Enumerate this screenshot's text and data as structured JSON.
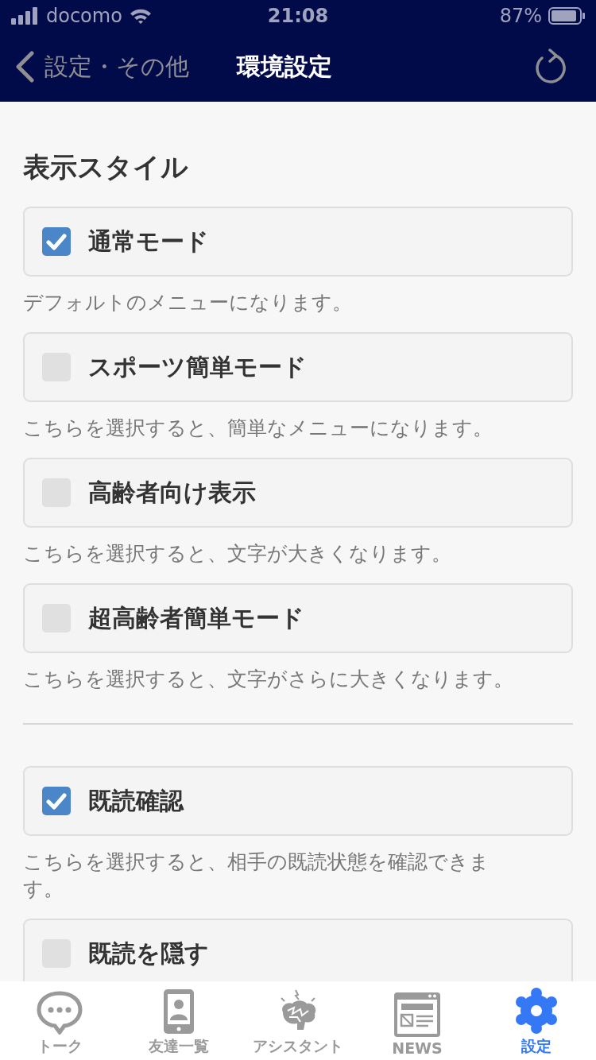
{
  "status_bar": {
    "carrier": "docomo",
    "time": "21:08",
    "battery": "87%"
  },
  "nav": {
    "back": "設定・その他",
    "title": "環境設定"
  },
  "sections": [
    {
      "title": "表示スタイル",
      "options": [
        {
          "label": "通常モード",
          "checked": true,
          "description": "デフォルトのメニューになります。"
        },
        {
          "label": "スポーツ簡単モード",
          "checked": false,
          "description": "こちらを選択すると、簡単なメニューになります。"
        },
        {
          "label": "高齢者向け表示",
          "checked": false,
          "description": "こちらを選択すると、文字が大きくなります。"
        },
        {
          "label": "超高齢者簡単モード",
          "checked": false,
          "description": "こちらを選択すると、文字がさらに大きくなります。"
        }
      ]
    },
    {
      "options": [
        {
          "label": "既読確認",
          "checked": true,
          "description": "こちらを選択すると、相手の既読状態を確認できます。"
        },
        {
          "label": "既読を隠す",
          "checked": false
        }
      ]
    }
  ],
  "tab_bar": [
    {
      "kind": "talk",
      "label": "トーク",
      "selected": false
    },
    {
      "kind": "friends",
      "label": "友達一覧",
      "selected": false
    },
    {
      "kind": "assistant",
      "label": "アシスタント",
      "selected": false
    },
    {
      "kind": "news",
      "label": "NEWS",
      "selected": false
    },
    {
      "kind": "settings",
      "label": "設定",
      "selected": true
    }
  ]
}
